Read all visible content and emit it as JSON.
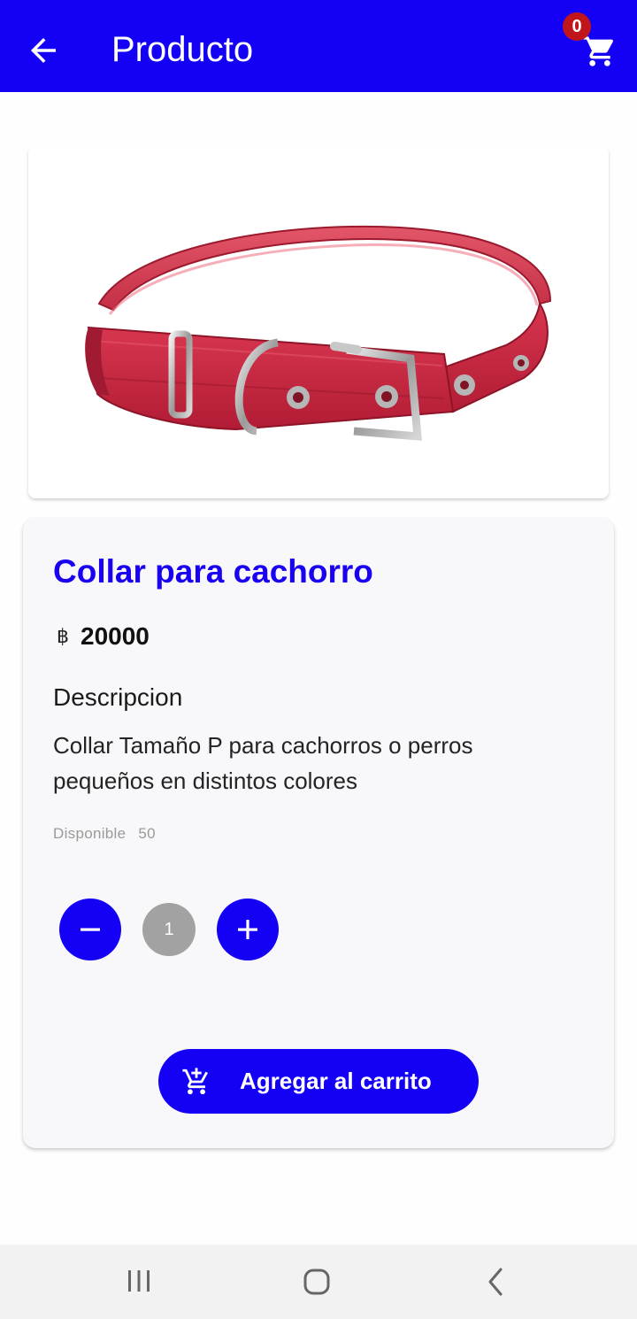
{
  "app_bar": {
    "title": "Producto",
    "background": "#1400f5",
    "back_icon": "arrow-left-icon",
    "cart_icon": "shopping-cart-icon",
    "cart_count": "0"
  },
  "product": {
    "image_description_icon": "red-dog-collar-image",
    "name": "Collar para cachorro",
    "currency_symbol": "฿",
    "price": "20000",
    "description_heading": "Descripcion",
    "description": "Collar Tamaño P para cachorros o perros pequeños en distintos colores",
    "stock_label": "Disponible",
    "stock_value": "50"
  },
  "quantity": {
    "minus_icon": "minus-icon",
    "value": "1",
    "plus_icon": "plus-icon"
  },
  "add_to_cart": {
    "label": "Agregar al carrito",
    "icon": "add-shopping-cart-icon"
  },
  "system_nav": {
    "recent_icon": "recent-apps-icon",
    "home_icon": "home-icon",
    "back_icon": "nav-back-icon"
  }
}
